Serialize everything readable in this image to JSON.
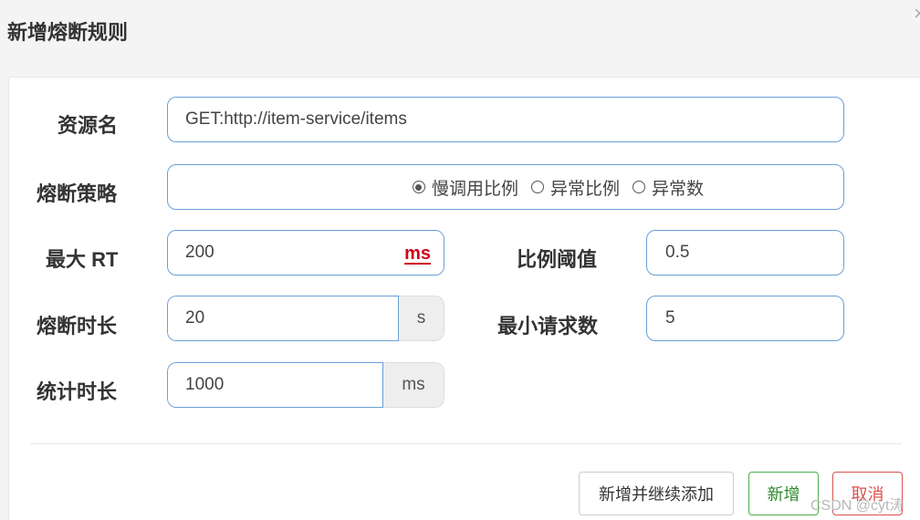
{
  "dialog": {
    "title": "新增熔断规则",
    "close_glyph": "×"
  },
  "form": {
    "resource_label": "资源名",
    "resource_value": "GET:http://item-service/items",
    "strategy_label": "熔断策略",
    "strategy_options": [
      {
        "label": "慢调用比例",
        "checked": true
      },
      {
        "label": "异常比例",
        "checked": false
      },
      {
        "label": "异常数",
        "checked": false
      }
    ],
    "max_rt_label": "最大 RT",
    "max_rt_value": "200",
    "max_rt_unit": "ms",
    "ratio_label": "比例阈值",
    "ratio_value": "0.5",
    "break_duration_label": "熔断时长",
    "break_duration_value": "20",
    "break_duration_unit": "s",
    "min_requests_label": "最小请求数",
    "min_requests_value": "5",
    "stat_duration_label": "统计时长",
    "stat_duration_value": "1000",
    "stat_duration_unit": "ms"
  },
  "footer": {
    "continue_label": "新增并继续添加",
    "add_label": "新增",
    "cancel_label": "取消"
  },
  "watermark": "CSDN @cyt涛",
  "colors": {
    "input_border": "#6aa0d8",
    "add_green": "#4cae4c",
    "cancel_red": "#d9534f",
    "unit_red": "#d0021b"
  }
}
